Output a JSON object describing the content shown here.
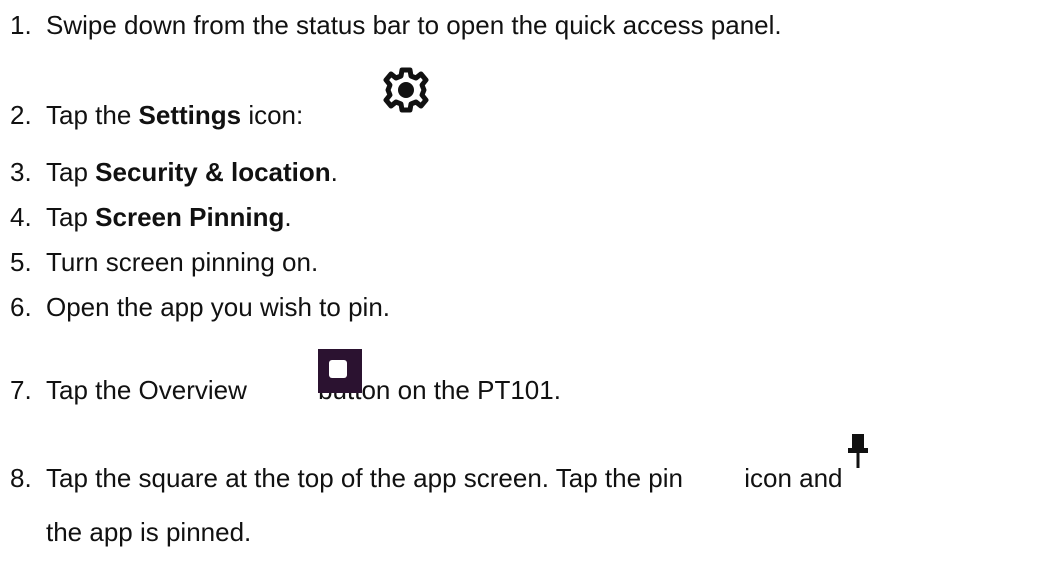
{
  "steps": [
    {
      "num": "1.",
      "text": "Swipe down from the status bar to open the quick access panel."
    },
    {
      "num": "2.",
      "pre": "Tap the ",
      "bold": "Settings",
      "post": " icon:",
      "icon": "gear-icon"
    },
    {
      "num": "3.",
      "pre": "Tap ",
      "bold": "Security & location",
      "post": "."
    },
    {
      "num": "4.",
      "pre": "Tap ",
      "bold": "Screen Pinning",
      "post": "."
    },
    {
      "num": "5.",
      "text": "Turn screen pinning on."
    },
    {
      "num": "6.",
      "text": "Open the app you wish to pin."
    },
    {
      "num": "7.",
      "pre": "Tap the Overview ",
      "post": "button on the PT101.",
      "icon": "overview-square-icon"
    },
    {
      "num": "8.",
      "pre": "Tap the square at the top of the app screen. Tap the pin ",
      "post": "icon and",
      "cont": "the app is pinned.",
      "icon": "pin-icon"
    }
  ],
  "colors": {
    "text": "#111111",
    "overview_button": "#2b1230"
  }
}
